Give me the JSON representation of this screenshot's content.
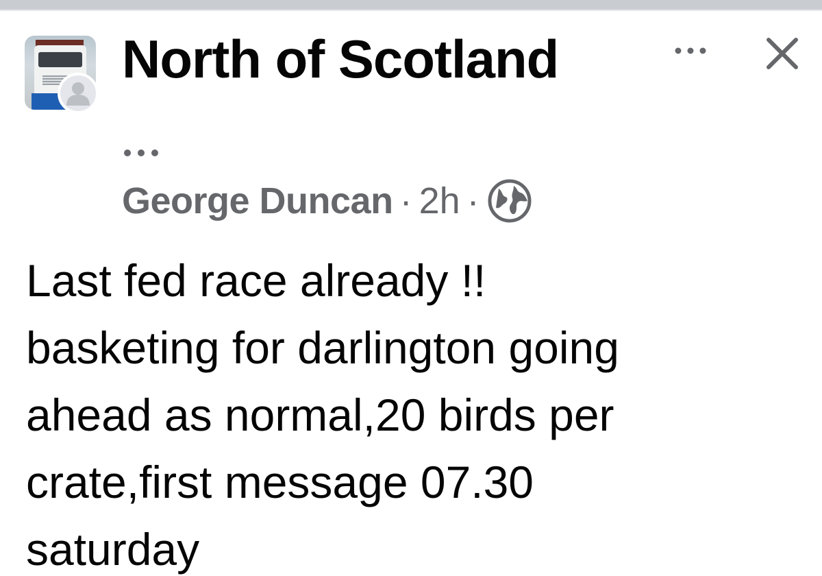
{
  "header": {
    "group_name": "North of Scotland",
    "more_icon": "more-horizontal-icon",
    "close_icon": "close-icon"
  },
  "post": {
    "more_icon": "more-horizontal-icon",
    "author": "George Duncan",
    "separator": "·",
    "time": "2h",
    "privacy_icon": "globe-icon",
    "body_lines": [
      "Last fed race already !!",
      "basketing for darlington going",
      "ahead as normal,20 birds per",
      "crate,first message 07.30",
      "saturday"
    ]
  },
  "colors": {
    "primary_text": "#050505",
    "secondary_text": "#65676b",
    "top_bar": "#c9ccd1",
    "avatar_placeholder": "#bcc0c4"
  }
}
